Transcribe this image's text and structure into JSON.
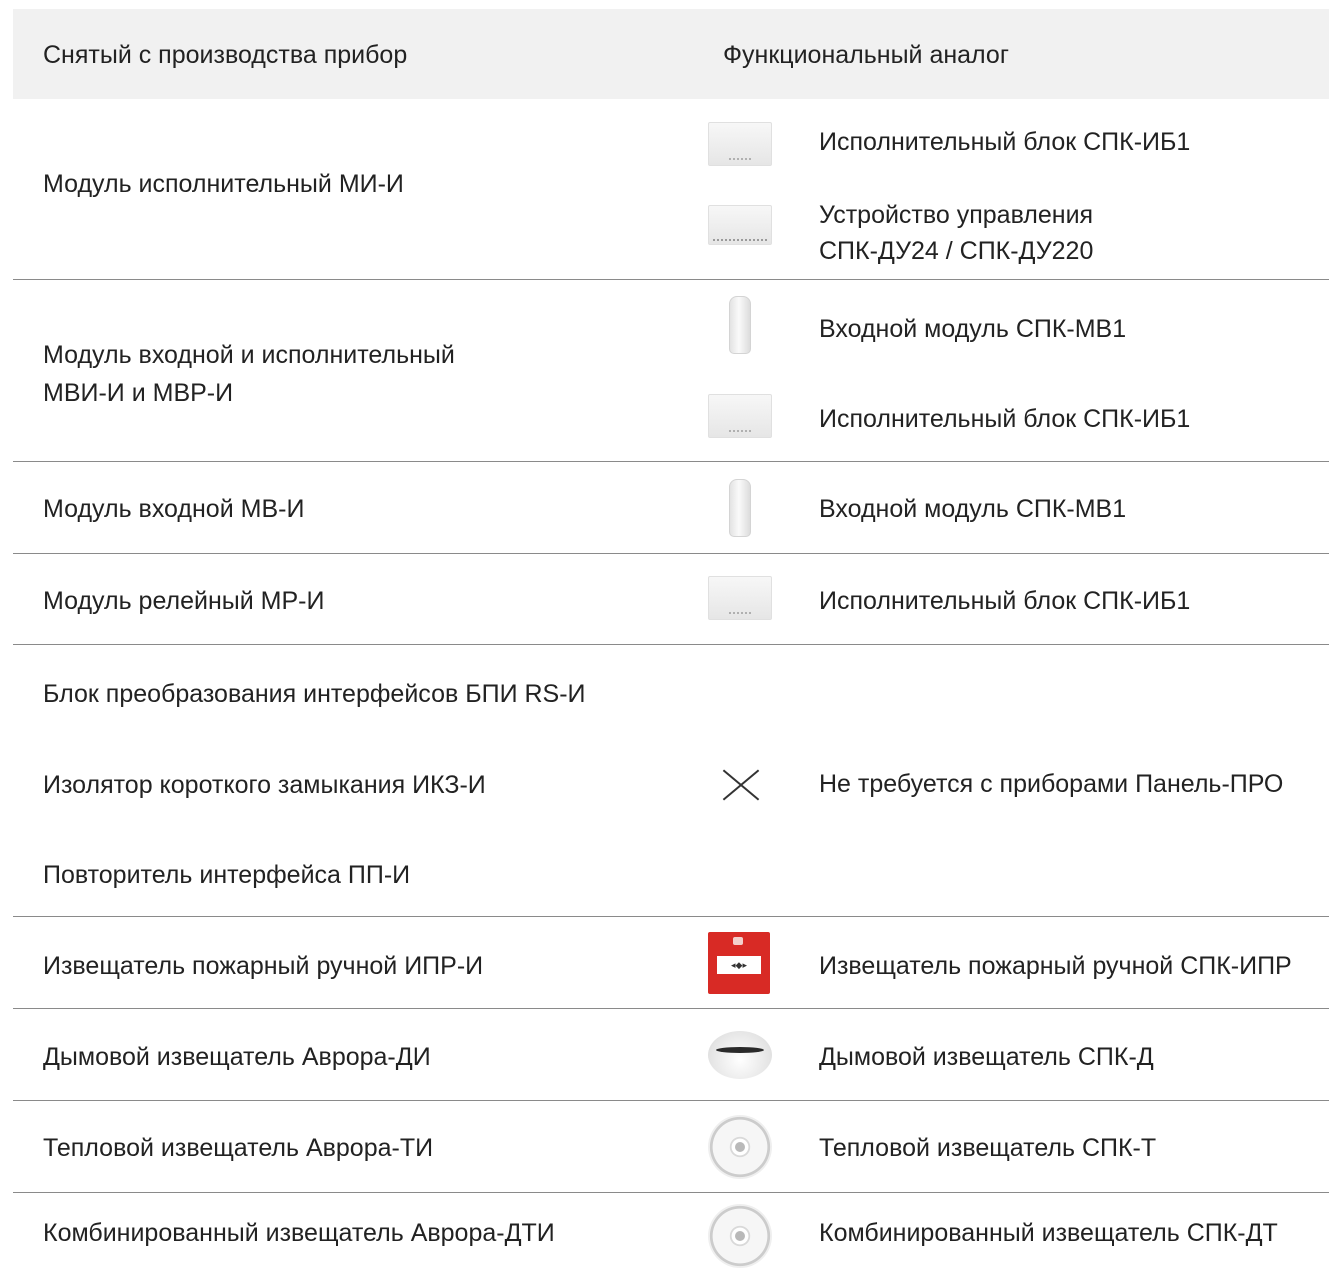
{
  "header": {
    "col_discontinued": "Снятый с производства прибор",
    "col_analog": "Функциональный аналог"
  },
  "rows": [
    {
      "discontinued": "Модуль исполнительный МИ-И",
      "analogs": [
        {
          "icon": "executive-block-icon",
          "name": "Исполнительный блок СПК-ИБ1"
        },
        {
          "icon": "control-device-icon",
          "name_line1": "Устройство управления",
          "name_line2": "СПК-ДУ24 / СПК-ДУ220"
        }
      ]
    },
    {
      "discontinued_line1": "Модуль входной и исполнительный",
      "discontinued_line2": "МВИ-И и МВР-И",
      "analogs": [
        {
          "icon": "input-module-icon",
          "name": "Входной модуль СПК-МВ1"
        },
        {
          "icon": "executive-block-icon",
          "name": "Исполнительный блок СПК-ИБ1"
        }
      ]
    },
    {
      "discontinued": "Модуль входной МВ-И",
      "analogs": [
        {
          "icon": "input-module-icon",
          "name": "Входной модуль СПК-МВ1"
        }
      ]
    },
    {
      "discontinued": "Модуль релейный МР-И",
      "analogs": [
        {
          "icon": "executive-block-icon",
          "name": "Исполнительный блок СПК-ИБ1"
        }
      ]
    },
    {
      "discontinued_items": [
        "Блок преобразования интерфейсов БПИ RS-И",
        "Изолятор короткого замыкания ИКЗ-И",
        "Повторитель интерфейса ПП-И"
      ],
      "analogs": [
        {
          "icon": "cross-icon",
          "name": "Не требуется с приборами Панель-ПРО"
        }
      ]
    },
    {
      "discontinued": "Извещатель пожарный ручной ИПР-И",
      "analogs": [
        {
          "icon": "manual-call-point-icon",
          "name": "Извещатель пожарный ручной СПК-ИПР"
        }
      ]
    },
    {
      "discontinued": "Дымовой извещатель Аврора-ДИ",
      "analogs": [
        {
          "icon": "smoke-detector-icon",
          "name": "Дымовой извещатель СПК-Д"
        }
      ]
    },
    {
      "discontinued": "Тепловой извещатель Аврора-ТИ",
      "analogs": [
        {
          "icon": "heat-detector-icon",
          "name": "Тепловой извещатель СПК-Т"
        }
      ]
    },
    {
      "discontinued": "Комбинированный извещатель Аврора-ДТИ",
      "analogs": [
        {
          "icon": "combined-detector-icon",
          "name": "Комбинированный извещатель СПК-ДТ"
        }
      ]
    }
  ]
}
